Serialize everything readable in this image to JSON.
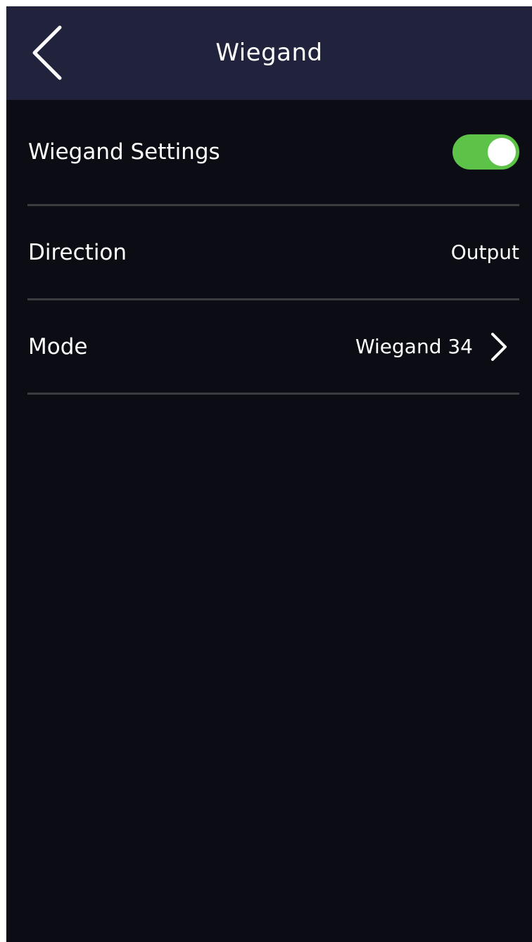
{
  "header": {
    "title": "Wiegand",
    "back_icon": "chevron-left-icon"
  },
  "settings": {
    "wiegand_settings": {
      "label": "Wiegand Settings",
      "enabled": true,
      "toggle_color": "#5cc348"
    },
    "direction": {
      "label": "Direction",
      "value": "Output"
    },
    "mode": {
      "label": "Mode",
      "value": "Wiegand 34",
      "icon": "chevron-right-icon"
    }
  },
  "colors": {
    "header_bg": "#21223b",
    "screen_bg": "#0b0c14",
    "divider": "#3b3c40",
    "text": "#ffffff"
  }
}
